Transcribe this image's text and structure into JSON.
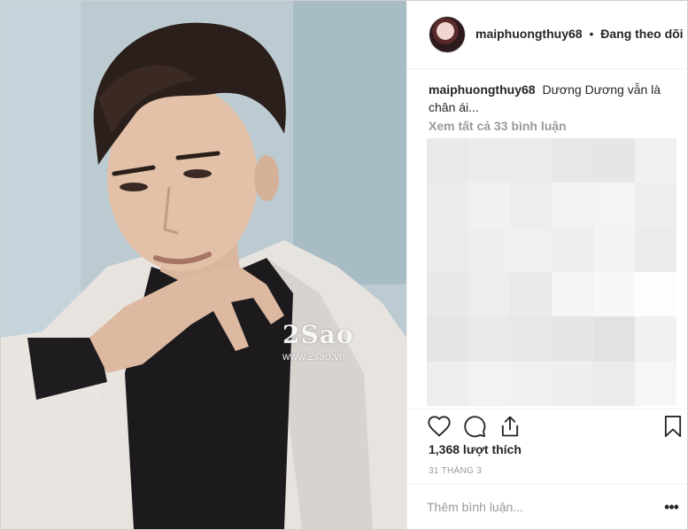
{
  "post": {
    "username": "maiphuongthuy68",
    "separator": "•",
    "follow_status": "Đang theo dõi",
    "caption_text": "Dương Dương vẫn là chân ái...",
    "view_comments": "Xem tất cả 33 bình luận",
    "likes": "1,368 lượt thích",
    "date": "31 THÁNG 3"
  },
  "watermark": {
    "logo": "2Sao",
    "url": "www.2sao.vn"
  },
  "comment_box": {
    "placeholder": "Thêm bình luận...",
    "more": "•••"
  },
  "icons": {
    "like": "heart-icon",
    "comment": "comment-bubble-icon",
    "share": "share-icon",
    "save": "bookmark-icon",
    "more": "more-options-icon"
  },
  "colors": {
    "text": "#262626",
    "muted": "#999999",
    "divider": "#efefef"
  }
}
